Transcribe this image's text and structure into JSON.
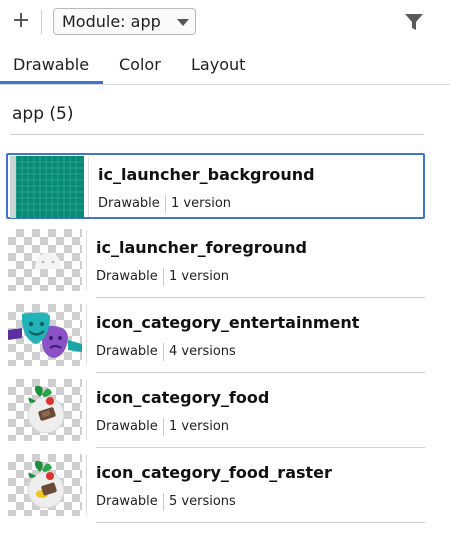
{
  "toolbar": {
    "add_icon": "plus-icon",
    "module_label": "Module: app",
    "filter_icon": "filter-icon"
  },
  "tabs": [
    {
      "label": "Drawable",
      "active": true
    },
    {
      "label": "Color",
      "active": false
    },
    {
      "label": "Layout",
      "active": false
    }
  ],
  "group": {
    "title": "app (5)"
  },
  "items": [
    {
      "name": "ic_launcher_background",
      "type": "Drawable",
      "versions": "1 version",
      "selected": true
    },
    {
      "name": "ic_launcher_foreground",
      "type": "Drawable",
      "versions": "1 version",
      "selected": false
    },
    {
      "name": "icon_category_entertainment",
      "type": "Drawable",
      "versions": "4 versions",
      "selected": false
    },
    {
      "name": "icon_category_food",
      "type": "Drawable",
      "versions": "1 version",
      "selected": false
    },
    {
      "name": "icon_category_food_raster",
      "type": "Drawable",
      "versions": "5 versions",
      "selected": false
    }
  ],
  "colors": {
    "accent": "#3f74d0",
    "launcher_bg": "#078b76"
  }
}
